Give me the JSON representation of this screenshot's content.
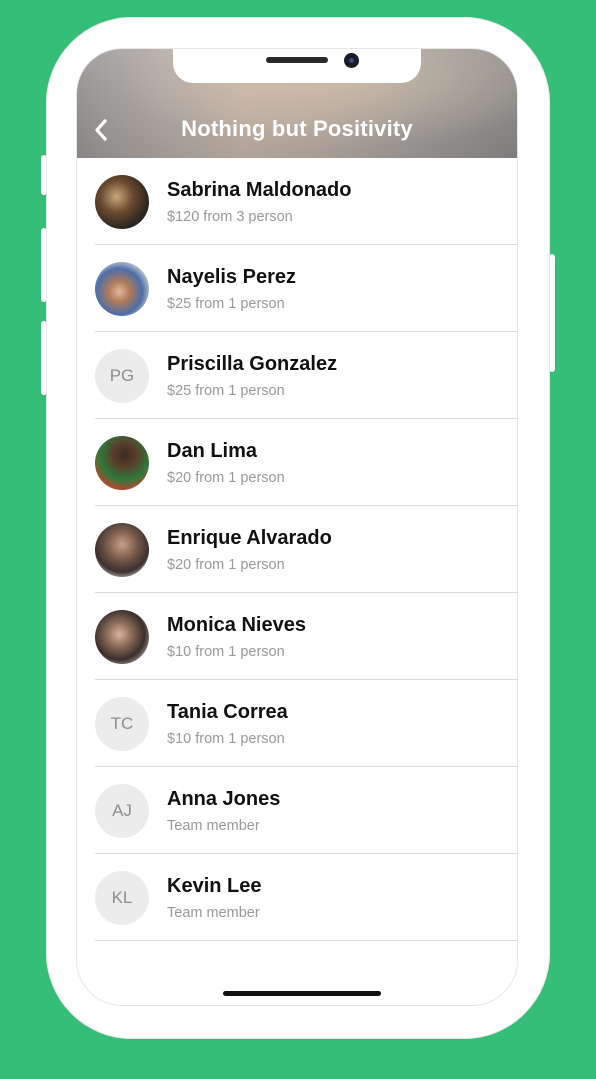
{
  "header": {
    "title": "Nothing but Positivity",
    "back_icon": "chevron-left-icon"
  },
  "members": [
    {
      "name": "Sabrina Maldonado",
      "sub": "$120 from 3 person",
      "initials": "",
      "photo": "photo-1"
    },
    {
      "name": "Nayelis Perez",
      "sub": "$25 from 1 person",
      "initials": "",
      "photo": "photo-2"
    },
    {
      "name": "Priscilla Gonzalez",
      "sub": "$25 from 1 person",
      "initials": "PG",
      "photo": ""
    },
    {
      "name": "Dan Lima",
      "sub": "$20 from 1 person",
      "initials": "",
      "photo": "photo-3"
    },
    {
      "name": "Enrique Alvarado",
      "sub": "$20 from 1 person",
      "initials": "",
      "photo": "photo-4"
    },
    {
      "name": "Monica Nieves",
      "sub": "$10 from 1 person",
      "initials": "",
      "photo": "photo-5"
    },
    {
      "name": "Tania Correa",
      "sub": "$10 from 1 person",
      "initials": "TC",
      "photo": ""
    },
    {
      "name": "Anna Jones",
      "sub": "Team member",
      "initials": "AJ",
      "photo": ""
    },
    {
      "name": "Kevin Lee",
      "sub": "Team member",
      "initials": "KL",
      "photo": ""
    }
  ],
  "colors": {
    "background": "#35BE78",
    "name": "#111111",
    "subtext": "#9a9a9a"
  }
}
